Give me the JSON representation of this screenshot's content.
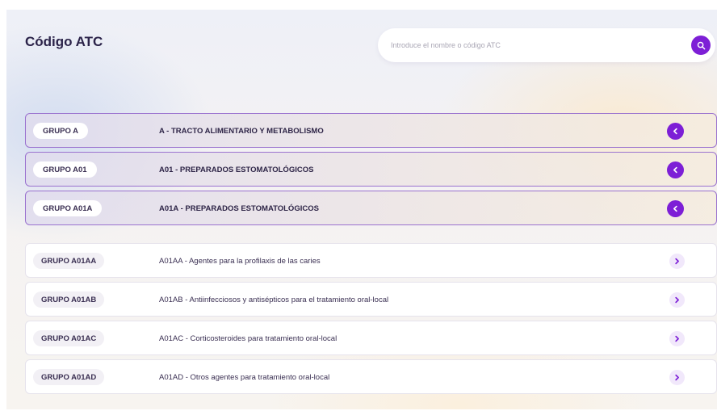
{
  "header": {
    "title": "Código ATC"
  },
  "search": {
    "placeholder": "Introduce el nombre o código ATC",
    "value": "",
    "button_icon": "search-icon"
  },
  "colors": {
    "accent": "#7d1fd6",
    "parent_border": "#9a72cf",
    "text_dark": "#2b2349"
  },
  "parent_groups": [
    {
      "badge": "GRUPO A",
      "label": "A - TRACTO ALIMENTARIO Y METABOLISMO",
      "icon": "chevron-left-icon"
    },
    {
      "badge": "GRUPO A01",
      "label": "A01 - PREPARADOS ESTOMATOLÓGICOS",
      "icon": "chevron-left-icon"
    },
    {
      "badge": "GRUPO A01A",
      "label": "A01A - PREPARADOS ESTOMATOLÓGICOS",
      "icon": "chevron-left-icon"
    }
  ],
  "subgroups": [
    {
      "badge": "GRUPO A01AA",
      "label": "A01AA - Agentes para la profilaxis de las caries",
      "icon": "chevron-right-icon"
    },
    {
      "badge": "GRUPO A01AB",
      "label": "A01AB - Antiinfecciosos y antisépticos para el tratamiento oral-local",
      "icon": "chevron-right-icon"
    },
    {
      "badge": "GRUPO A01AC",
      "label": "A01AC - Corticosteroides para tratamiento oral-local",
      "icon": "chevron-right-icon"
    },
    {
      "badge": "GRUPO A01AD",
      "label": "A01AD - Otros agentes para tratamiento oral-local",
      "icon": "chevron-right-icon"
    }
  ]
}
